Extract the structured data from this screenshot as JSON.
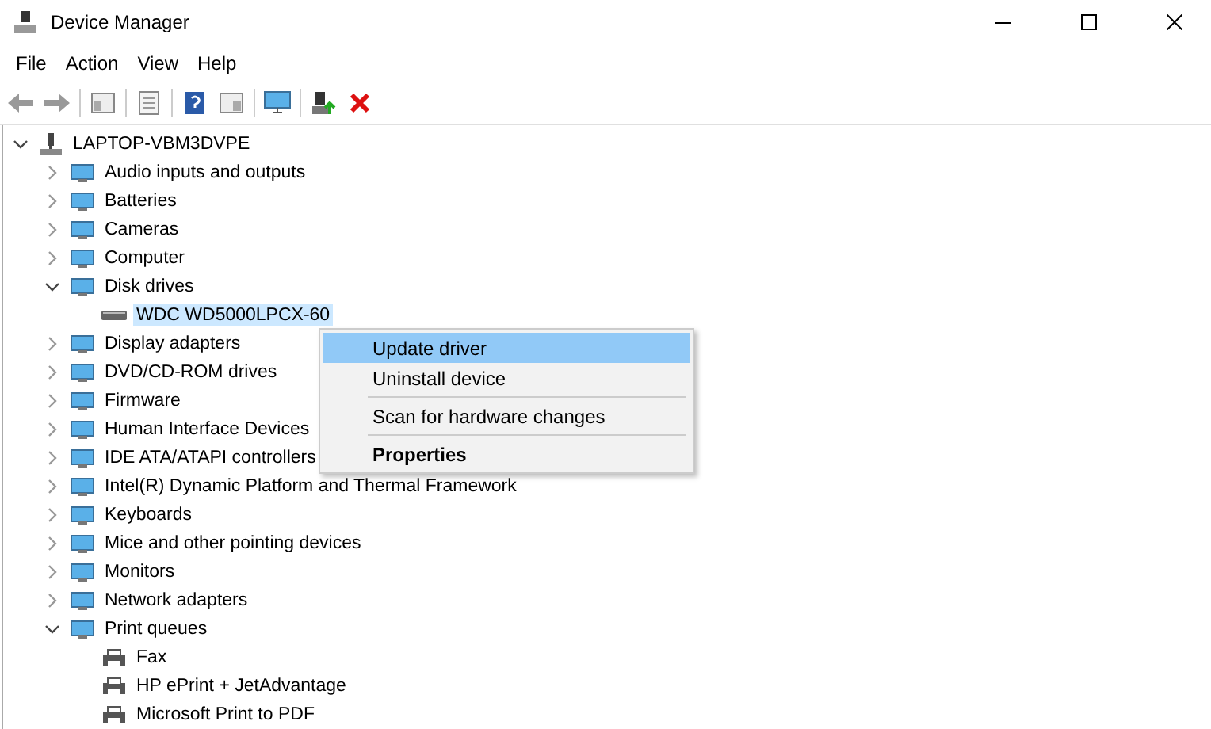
{
  "window": {
    "title": "Device Manager"
  },
  "menu": [
    "File",
    "Action",
    "View",
    "Help"
  ],
  "tree": [
    {
      "label": "LAPTOP-VBM3DVPE",
      "expanded": true,
      "selected": false,
      "children": [
        {
          "label": "Audio inputs and outputs",
          "expanded": false,
          "selected": false
        },
        {
          "label": "Batteries",
          "expanded": false,
          "selected": false
        },
        {
          "label": "Cameras",
          "expanded": false,
          "selected": false
        },
        {
          "label": "Computer",
          "expanded": false,
          "selected": false
        },
        {
          "label": "Disk drives",
          "expanded": true,
          "selected": false,
          "children": [
            {
              "label": "WDC WD5000LPCX-60",
              "selected": true
            }
          ]
        },
        {
          "label": "Display adapters",
          "expanded": false,
          "selected": false
        },
        {
          "label": "DVD/CD-ROM drives",
          "expanded": false,
          "selected": false
        },
        {
          "label": "Firmware",
          "expanded": false,
          "selected": false
        },
        {
          "label": "Human Interface Devices",
          "expanded": false,
          "selected": false
        },
        {
          "label": "IDE ATA/ATAPI controllers",
          "expanded": false,
          "selected": false
        },
        {
          "label": "Intel(R) Dynamic Platform and Thermal Framework",
          "expanded": false,
          "selected": false
        },
        {
          "label": "Keyboards",
          "expanded": false,
          "selected": false
        },
        {
          "label": "Mice and other pointing devices",
          "expanded": false,
          "selected": false
        },
        {
          "label": "Monitors",
          "expanded": false,
          "selected": false
        },
        {
          "label": "Network adapters",
          "expanded": false,
          "selected": false
        },
        {
          "label": "Print queues",
          "expanded": true,
          "selected": false,
          "children": [
            {
              "label": "Fax",
              "selected": false
            },
            {
              "label": "HP ePrint + JetAdvantage",
              "selected": false
            },
            {
              "label": "Microsoft Print to PDF",
              "selected": false
            }
          ]
        }
      ]
    }
  ],
  "context_menu": [
    {
      "kind": "item",
      "label": "Update driver",
      "selected": true,
      "default": false
    },
    {
      "kind": "item",
      "label": "Uninstall device",
      "selected": false,
      "default": false
    },
    {
      "kind": "separator"
    },
    {
      "kind": "item",
      "label": "Scan for hardware changes",
      "selected": false,
      "default": false
    },
    {
      "kind": "separator"
    },
    {
      "kind": "item",
      "label": "Properties",
      "selected": false,
      "default": true
    }
  ]
}
